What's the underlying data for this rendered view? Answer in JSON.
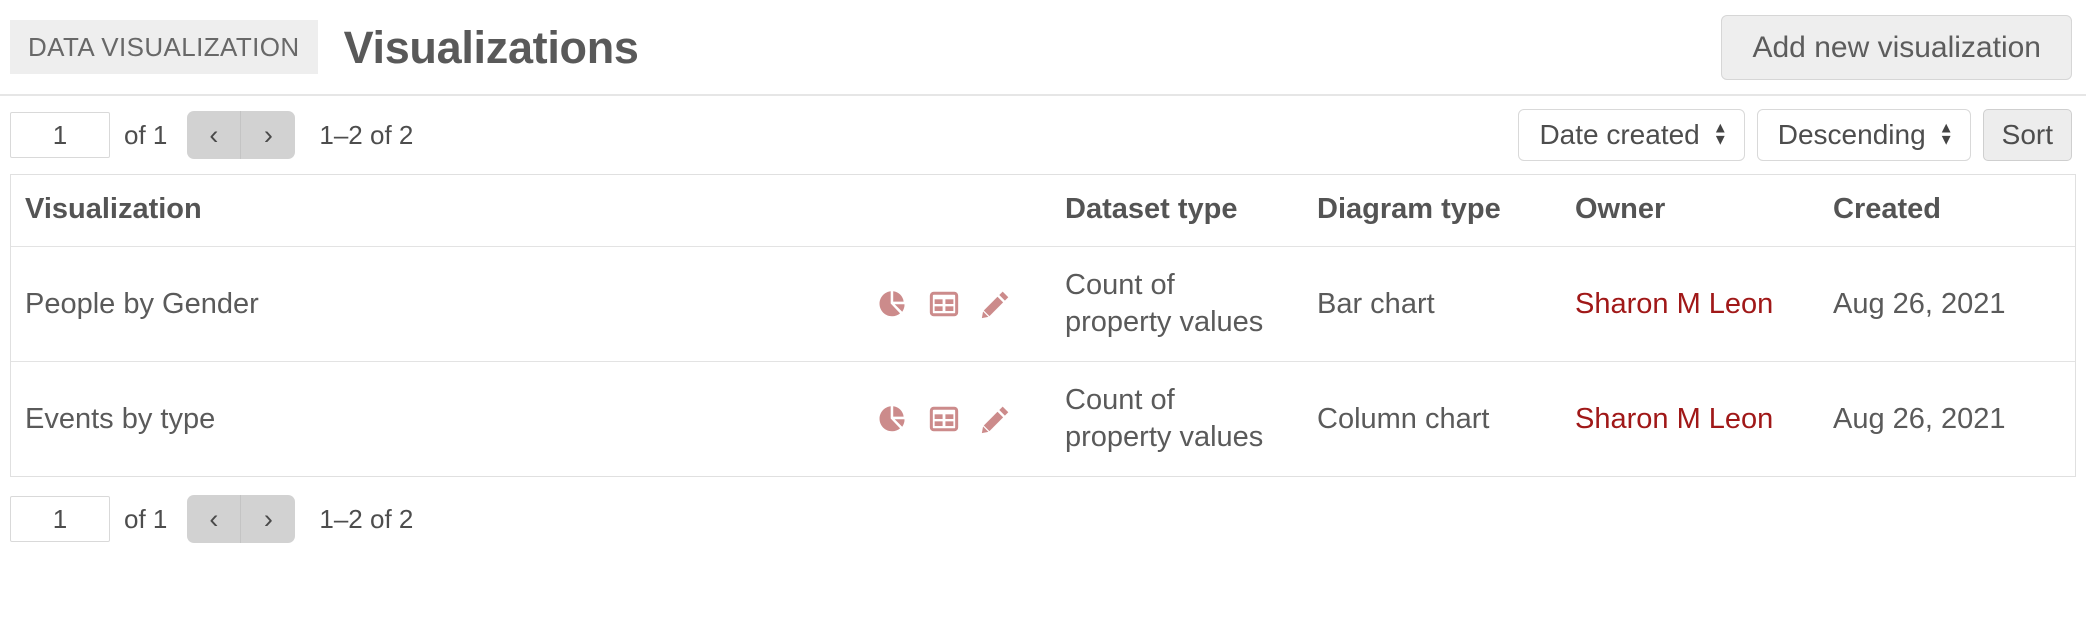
{
  "header": {
    "breadcrumb": "DATA VISUALIZATION",
    "title": "Visualizations",
    "add_button_label": "Add new visualization"
  },
  "pagination": {
    "page_value": "1",
    "of_label": "of 1",
    "prev_icon": "chevron-left-icon",
    "next_icon": "chevron-right-icon",
    "prev_glyph": "‹",
    "next_glyph": "›",
    "range_label": "1–2 of 2"
  },
  "sorting": {
    "sort_by": "Date created",
    "sort_direction": "Descending",
    "sort_button_label": "Sort"
  },
  "table": {
    "columns": [
      "Visualization",
      "Dataset type",
      "Diagram type",
      "Owner",
      "Created"
    ],
    "rows": [
      {
        "name": "People by Gender",
        "dataset_type": "Count of property values",
        "diagram_type": "Bar chart",
        "owner": "Sharon M Leon",
        "created": "Aug 26, 2021",
        "actions": [
          "pie-chart-icon",
          "table-icon",
          "pencil-icon"
        ]
      },
      {
        "name": "Events by type",
        "dataset_type": "Count of property values",
        "diagram_type": "Column chart",
        "owner": "Sharon M Leon",
        "created": "Aug 26, 2021",
        "actions": [
          "pie-chart-icon",
          "table-icon",
          "pencil-icon"
        ]
      }
    ]
  },
  "colors": {
    "icon_rose": "#cc8b8b",
    "owner_link": "#a01818",
    "breadcrumb_bg": "#eeeeee",
    "button_bg": "#eeeeee",
    "text": "#4d4d4d"
  }
}
